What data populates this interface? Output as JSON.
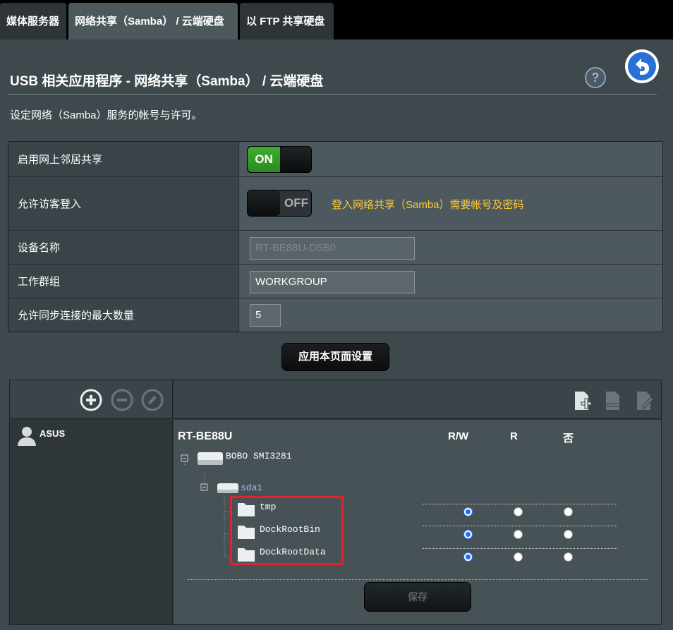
{
  "tabs": [
    {
      "label": "媒体服务器"
    },
    {
      "label": "网络共享（Samba） / 云端硬盘"
    },
    {
      "label": "以 FTP 共享硬盘"
    }
  ],
  "header": {
    "title": "USB 相关应用程序 - 网络共享（Samba） / 云端硬盘",
    "help_glyph": "?",
    "description": "设定网络（Samba）服务的帐号与许可。"
  },
  "settings": {
    "network_place_sharing": {
      "label": "启用网上邻居共享",
      "state": "ON"
    },
    "allow_guest": {
      "label": "允许访客登入",
      "state": "OFF",
      "hint": "登入网络共享（Samba）需要帐号及密码"
    },
    "device_name": {
      "label": "设备名称",
      "value": "RT-BE88U-D5B0"
    },
    "workgroup": {
      "label": "工作群组",
      "value": "WORKGROUP"
    },
    "max_connections": {
      "label": "允许同步连接的最大数量",
      "value": "5"
    },
    "apply_label": "应用本页面设置"
  },
  "accounts": {
    "users": [
      {
        "name": "ASUS"
      }
    ]
  },
  "permissions": {
    "device": "RT-BE88U",
    "columns": [
      "R/W",
      "R",
      "否"
    ],
    "disk": "BOBO SMI3281",
    "partition": "sda1",
    "folders": [
      {
        "name": "tmp",
        "permission": "R/W"
      },
      {
        "name": "DockRootBin",
        "permission": "R/W"
      },
      {
        "name": "DockRootData",
        "permission": "R/W"
      }
    ],
    "save_label": "保存"
  },
  "colors": {
    "accent_on": "#3fae32",
    "hint": "#ffcc33",
    "highlight_box": "#e8202e"
  }
}
